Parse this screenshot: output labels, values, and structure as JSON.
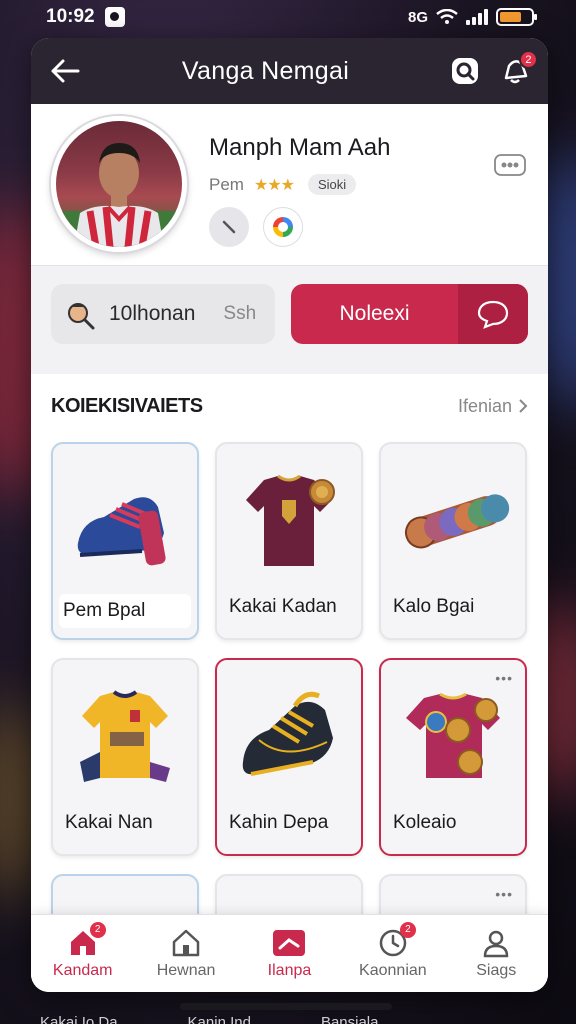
{
  "status_bar": {
    "time": "10:92",
    "network": "8G"
  },
  "header": {
    "title": "Vanga Nemgai",
    "notifications": "2"
  },
  "profile": {
    "name": "Manph Mam Aah",
    "rank_label": "Pem",
    "stars": "★★★",
    "badge": "Sioki",
    "more": "⋯"
  },
  "stats": {
    "label": "10lhonan",
    "value": "Ssh"
  },
  "cta": {
    "label": "Noleexi"
  },
  "collection": {
    "title": "KOIEKISIVAIETS",
    "link": "Ifenian",
    "items": [
      {
        "label": "Pem Bpal",
        "icon": "boot-blue-icon"
      },
      {
        "label": "Kakai Kadan",
        "icon": "jersey-maroon-icon"
      },
      {
        "label": "Kalo Bgai",
        "icon": "medals-stack-icon"
      },
      {
        "label": "Kakai Nan",
        "icon": "jersey-yellow-icon"
      },
      {
        "label": "Kahin Depa",
        "icon": "boot-black-icon"
      },
      {
        "label": "Koleaio",
        "icon": "jersey-pink-icon"
      }
    ]
  },
  "nav": {
    "items": [
      {
        "label": "Kandam",
        "badge": "2"
      },
      {
        "label": "Hewnan"
      },
      {
        "label": "Ilanpa"
      },
      {
        "label": "Kaonnian",
        "badge": "2"
      },
      {
        "label": "Siags"
      }
    ]
  },
  "peek": [
    "Kakai Io Da",
    "Kanin Ind",
    "Bansiala"
  ],
  "colors": {
    "accent": "#c8294d",
    "header": "#2a2530",
    "star": "#e8a928"
  }
}
